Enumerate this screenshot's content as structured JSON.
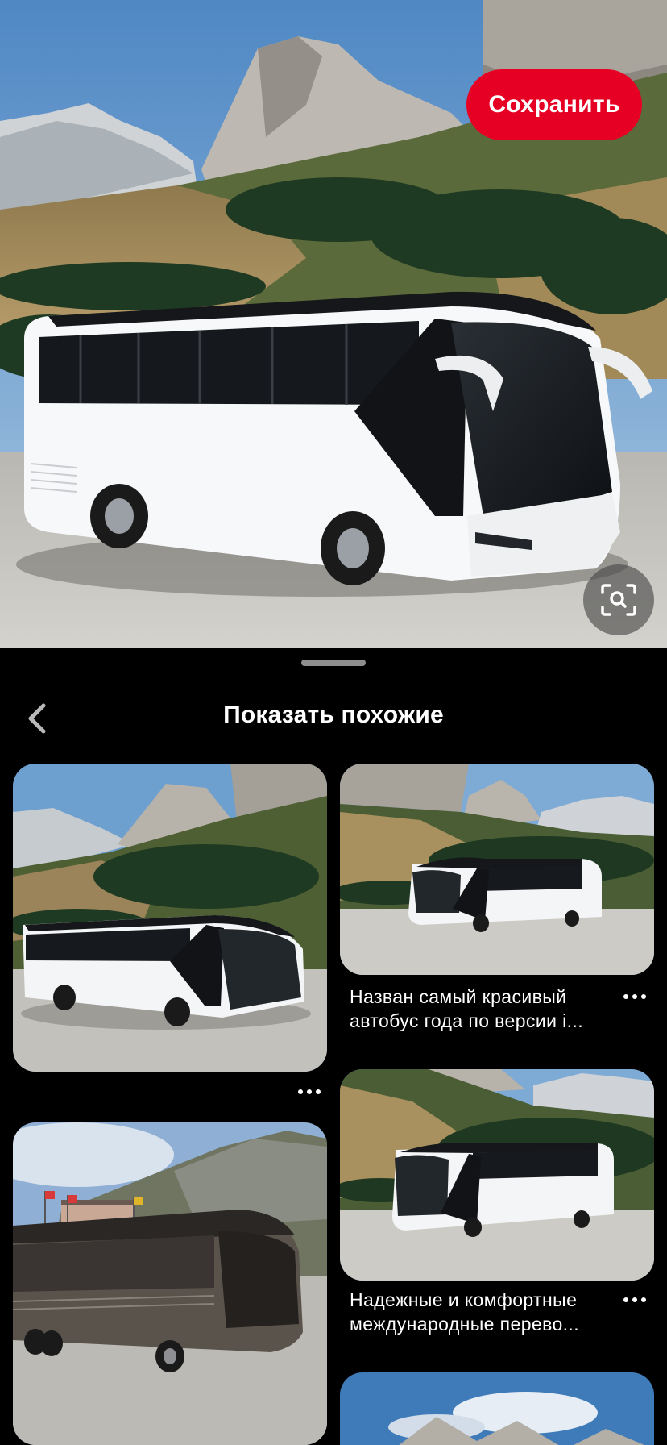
{
  "hero": {
    "save_label": "Сохранить",
    "lens_icon": "visual-search-icon"
  },
  "sheet": {
    "title": "Показать похожие",
    "back_icon": "chevron-left-icon"
  },
  "pins": [
    {
      "title_line1": "",
      "title_line2": ""
    },
    {
      "title_line1": "Назван самый красивый",
      "title_line2": "автобус года по версии i..."
    },
    {
      "title_line1": "",
      "title_line2": ""
    },
    {
      "title_line1": "Надежные и комфортные",
      "title_line2": "международные перево..."
    },
    {
      "title_line1": "",
      "title_line2": ""
    }
  ],
  "colors": {
    "accent": "#e60023",
    "background": "#000000",
    "text": "#ffffff"
  }
}
